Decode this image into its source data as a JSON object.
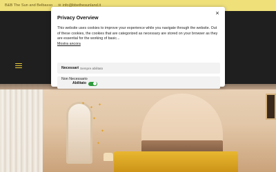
{
  "topbar": {
    "address": "B&B The Sun and Belbasso",
    "email": "info@bbethesunland.it",
    "address_icon": "map-pin-icon",
    "email_icon": "mail-icon"
  },
  "header": {
    "menu_icon": "hamburger-menu-icon"
  },
  "cookie_modal": {
    "title": "Privacy Overview",
    "description": "This website uses cookies to improve your experience while you navigate through the website. Out of these cookies, the cookies that are categorized as necessary are stored on your browser as they are essential for the working of basic...",
    "show_more": "Mostra ancora",
    "close_glyph": "×",
    "categories": [
      {
        "name": "Necessari",
        "status": "Sempre abilitato"
      },
      {
        "name": "Non Necessario",
        "toggle_label": "Abilitato",
        "enabled": true
      }
    ]
  },
  "colors": {
    "topbar": "#efe07a",
    "header": "#1f1f1f",
    "toggle_on": "#2e9a3c",
    "accent": "#f0d23a"
  }
}
